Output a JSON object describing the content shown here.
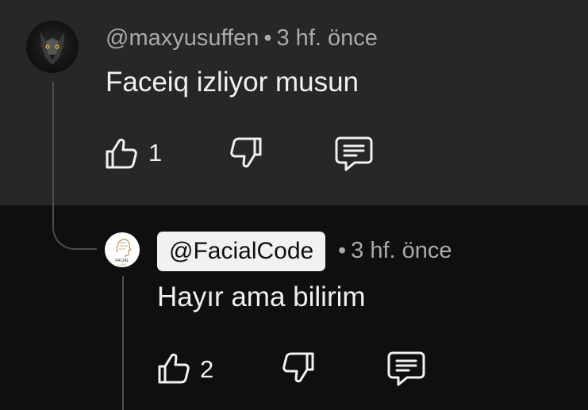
{
  "comment": {
    "author": "@maxyusuffen",
    "separator": "•",
    "time": "3 hf. önce",
    "text": "Faceiq izliyor musun",
    "like_count": "1",
    "avatar_icon": "wolf-avatar-icon"
  },
  "reply": {
    "author": "@FacialCode",
    "separator": "•",
    "time": "3 hf. önce",
    "text": "Hayır ama bilirim",
    "like_count": "2",
    "avatar_icon": "facial-code-logo",
    "avatar_logo_text": [
      "FACIAL",
      "CODE"
    ]
  },
  "icons": {
    "like": "thumb-up-icon",
    "dislike": "thumb-down-icon",
    "reply": "comment-icon"
  },
  "colors": {
    "top_background": "#272727",
    "reply_background": "#0f0f0f",
    "text": "#f1f1f1",
    "meta": "#aaaaaa",
    "chip_background": "#f1f1f1",
    "thread_line": "#4d4d4d"
  }
}
